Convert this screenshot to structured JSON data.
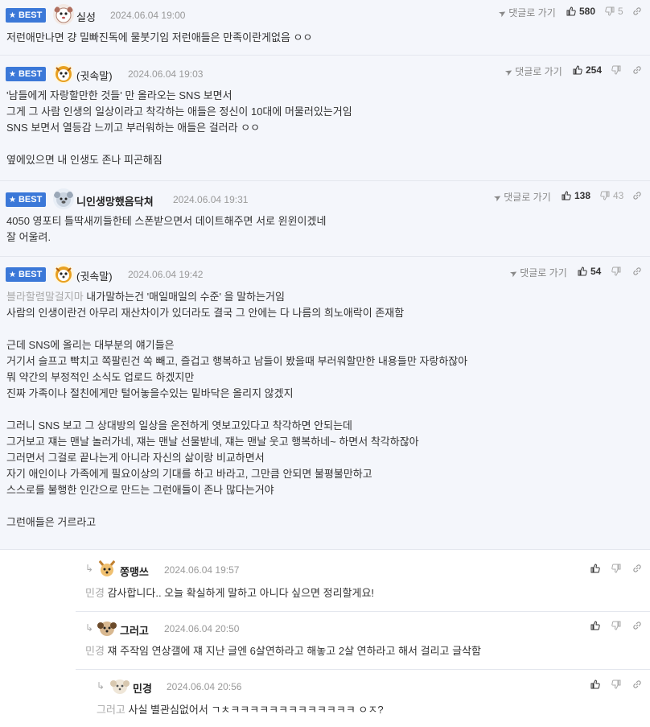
{
  "best_badge": "BEST",
  "reply_link": "댓글로 가기",
  "comments": [
    {
      "nick": "실성",
      "date": "2024.06.04 19:00",
      "likes": "580",
      "dislikes": "5",
      "lines": [
        "저런애만나면 걍 밀빠진독에 물붓기임 저런애들은 만족이란게없음 ㅇㅇ"
      ]
    },
    {
      "nick": "(귓속말)",
      "date": "2024.06.04 19:03",
      "likes": "254",
      "dislikes": "",
      "lines": [
        "'남들에게 자랑할만한 것들' 만 올라오는 SNS 보면서",
        "그게 그 사람 인생의 일상이라고 착각하는 애들은 정신이 10대에 머물러있는거임",
        "SNS 보면서 열등감 느끼고 부러워하는 애들은 걸러라 ㅇㅇ",
        "",
        "옆에있으면 내 인생도 존나 피곤해짐"
      ]
    },
    {
      "nick": "니인생망했음닥쳐",
      "date": "2024.06.04 19:31",
      "likes": "138",
      "dislikes": "43",
      "lines": [
        "4050 영포티 틀딱새끼들한테 스폰받으면서 데이트해주면 서로 윈윈이겠네",
        "잘 어울려."
      ]
    },
    {
      "nick": "(귓속말)",
      "date": "2024.06.04 19:42",
      "likes": "54",
      "dislikes": "",
      "mention": "블라할렴말걸지마",
      "first_line": " 내가말하는건 '매일매일의 수준' 을 말하는거임",
      "lines": [
        "사람의 인생이란건 아무리 재산차이가 있더라도 결국 그 안에는 다 나름의 희노애락이 존재함",
        "",
        "근데 SNS에 올리는 대부분의 얘기들은",
        "거기서 슬프고 빡치고 쪽팔린건 쏙 빼고, 즐겁고 행복하고 남들이 봤을때 부러워할만한 내용들만 자랑하잖아",
        "뭐 약간의 부정적인 소식도 업로드 하겠지만",
        "진짜 가족이나 절친에게만 털어놓을수있는 밑바닥은 올리지 않겠지",
        "",
        "그러니 SNS 보고 그 상대방의 일상을 온전하게 엿보고있다고 착각하면 안되는데",
        "그거보고 쟤는 맨날 놀러가네, 쟤는 맨날 선물받네, 쟤는 맨날 웃고 행복하네~ 하면서 착각하잖아",
        "그러면서 그걸로 끝나는게 아니라 자신의 삶이랑 비교하면서",
        "자기 애인이나 가족에게 필요이상의 기대를 하고 바라고, 그만큼 안되면 불평불만하고",
        "스스로를 불행한 인간으로 만드는 그런애들이 존나 많다는거야",
        "",
        "그런애들은 거르라고"
      ]
    }
  ],
  "replies": [
    {
      "nick": "쫑맹쓰",
      "date": "2024.06.04 19:57",
      "mention": "민경",
      "text": " 감사합니다.. 오늘 확실하게 말하고 아니다 싶으면 정리할게요!"
    },
    {
      "nick": "그러고",
      "date": "2024.06.04 20:50",
      "mention": "민경",
      "text": " 쟤 주작임 연상갤에 쟤 지난 글엔 6살연하라고 해놓고 2살 연하라고 해서 걸리고 글삭함"
    },
    {
      "nick": "민경",
      "date": "2024.06.04 20:56",
      "mention": "그러고",
      "text": " 사실 별관심없어서 ㄱㅊㅋㅋㅋㅋㅋㅋㅋㅋㅋㅋㅋㅋㅋ ㅇㅈ?"
    }
  ],
  "colors": {
    "badge": "#3b78d8",
    "best_bg": "#f4f6fb",
    "mention": "#a8a8a8"
  }
}
